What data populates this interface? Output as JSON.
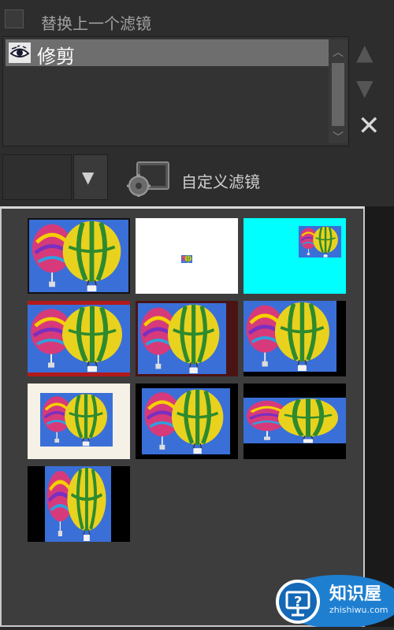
{
  "panel": {
    "replace_previous_label": "替换上一个滤镜",
    "filter_list": [
      {
        "label": "修剪"
      }
    ],
    "custom_filter_label": "自定义滤镜"
  },
  "thumbnail_presets": [
    {
      "variant": "normal"
    },
    {
      "variant": "tiny-center"
    },
    {
      "variant": "cyan-corner"
    },
    {
      "variant": "red-bars"
    },
    {
      "variant": "dark-red-border"
    },
    {
      "variant": "black-right"
    },
    {
      "variant": "white-frame"
    },
    {
      "variant": "black-frame"
    },
    {
      "variant": "letterbox"
    },
    {
      "variant": "pillarbox"
    }
  ],
  "watermark": {
    "label": "知识屋",
    "url": "zhishiwu.com"
  },
  "colors": {
    "sky": "#3a6fd8",
    "balloon_yellow": "#e8d21e",
    "balloon_green": "#2e8a2e",
    "balloon_pink": "#d73a7a",
    "cyan": "#00ffff",
    "watermark_blue": "#1e7fd0"
  },
  "icons": {
    "eye": "eye-icon",
    "up": "arrow-up-icon",
    "down": "arrow-down-icon",
    "remove": "close-icon",
    "custom": "gear-monitor-icon"
  }
}
